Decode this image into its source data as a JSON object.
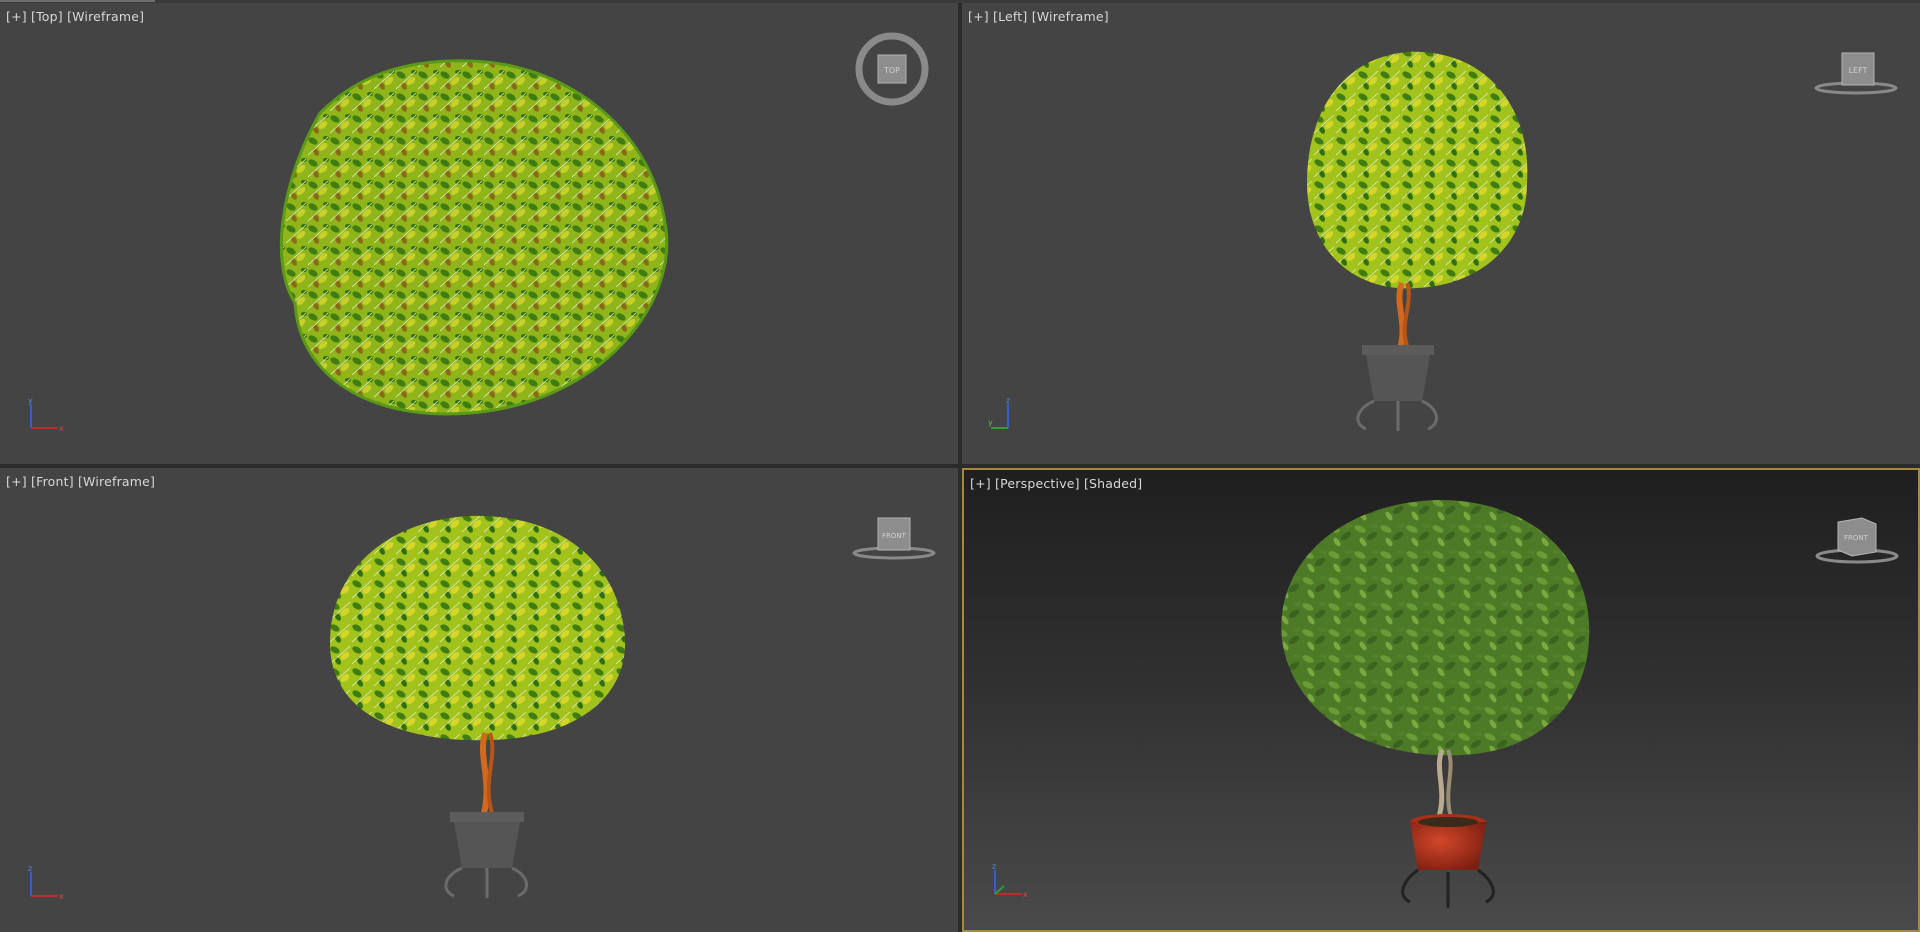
{
  "viewports": [
    {
      "menu": "[+]",
      "view": "[Top]",
      "mode": "[Wireframe]",
      "cube": "TOP",
      "axis": {
        "up": "y",
        "right": "x"
      }
    },
    {
      "menu": "[+]",
      "view": "[Left]",
      "mode": "[Wireframe]",
      "cube": "LEFT",
      "axis": {
        "up": "z",
        "right": "y"
      }
    },
    {
      "menu": "[+]",
      "view": "[Front]",
      "mode": "[Wireframe]",
      "cube": "FRONT",
      "axis": {
        "up": "z",
        "right": "x"
      }
    },
    {
      "menu": "[+]",
      "view": "[Perspective]",
      "mode": "[Shaded]",
      "cube": "FRONT",
      "axis": {
        "up": "z",
        "right": "x"
      }
    }
  ],
  "colors": {
    "viewport_bg": "#444444",
    "active_border": "#a58a3a",
    "foliage_wire": "#9bc31a",
    "foliage_shaded": "#5b8a2c",
    "trunk_wire": "#d2691e",
    "pot_wire": "#5c5c5c",
    "pot_shaded": "#b83318"
  }
}
